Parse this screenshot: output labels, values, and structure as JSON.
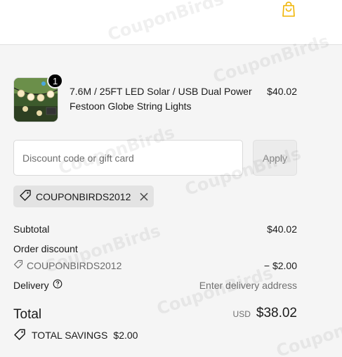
{
  "header": {
    "cart_icon": "shopping-bag-icon"
  },
  "product": {
    "quantity": "1",
    "title": "7.6M / 25FT LED Solar / USB Dual Power Festoon Globe String Lights",
    "price": "$40.02"
  },
  "discount": {
    "placeholder": "Discount code or gift card",
    "value": "",
    "apply_label": "Apply"
  },
  "applied_code": {
    "code": "COUPONBIRDS2012",
    "tag_icon": "tag-icon",
    "remove_icon": "close-icon"
  },
  "totals": {
    "subtotal_label": "Subtotal",
    "subtotal_value": "$40.02",
    "order_discount_label": "Order discount",
    "discount_code": "COUPONBIRDS2012",
    "discount_value": "− $2.00",
    "delivery_label": "Delivery",
    "delivery_value": "Enter delivery address",
    "total_label": "Total",
    "currency": "USD",
    "total_value": "$38.02",
    "savings_label": "TOTAL SAVINGS",
    "savings_value": "$2.00"
  },
  "watermark": "CouponBirds",
  "colors": {
    "accent": "#f0b400",
    "summary_bg": "#f5f5f5",
    "chip_bg": "#e3e3e3"
  }
}
